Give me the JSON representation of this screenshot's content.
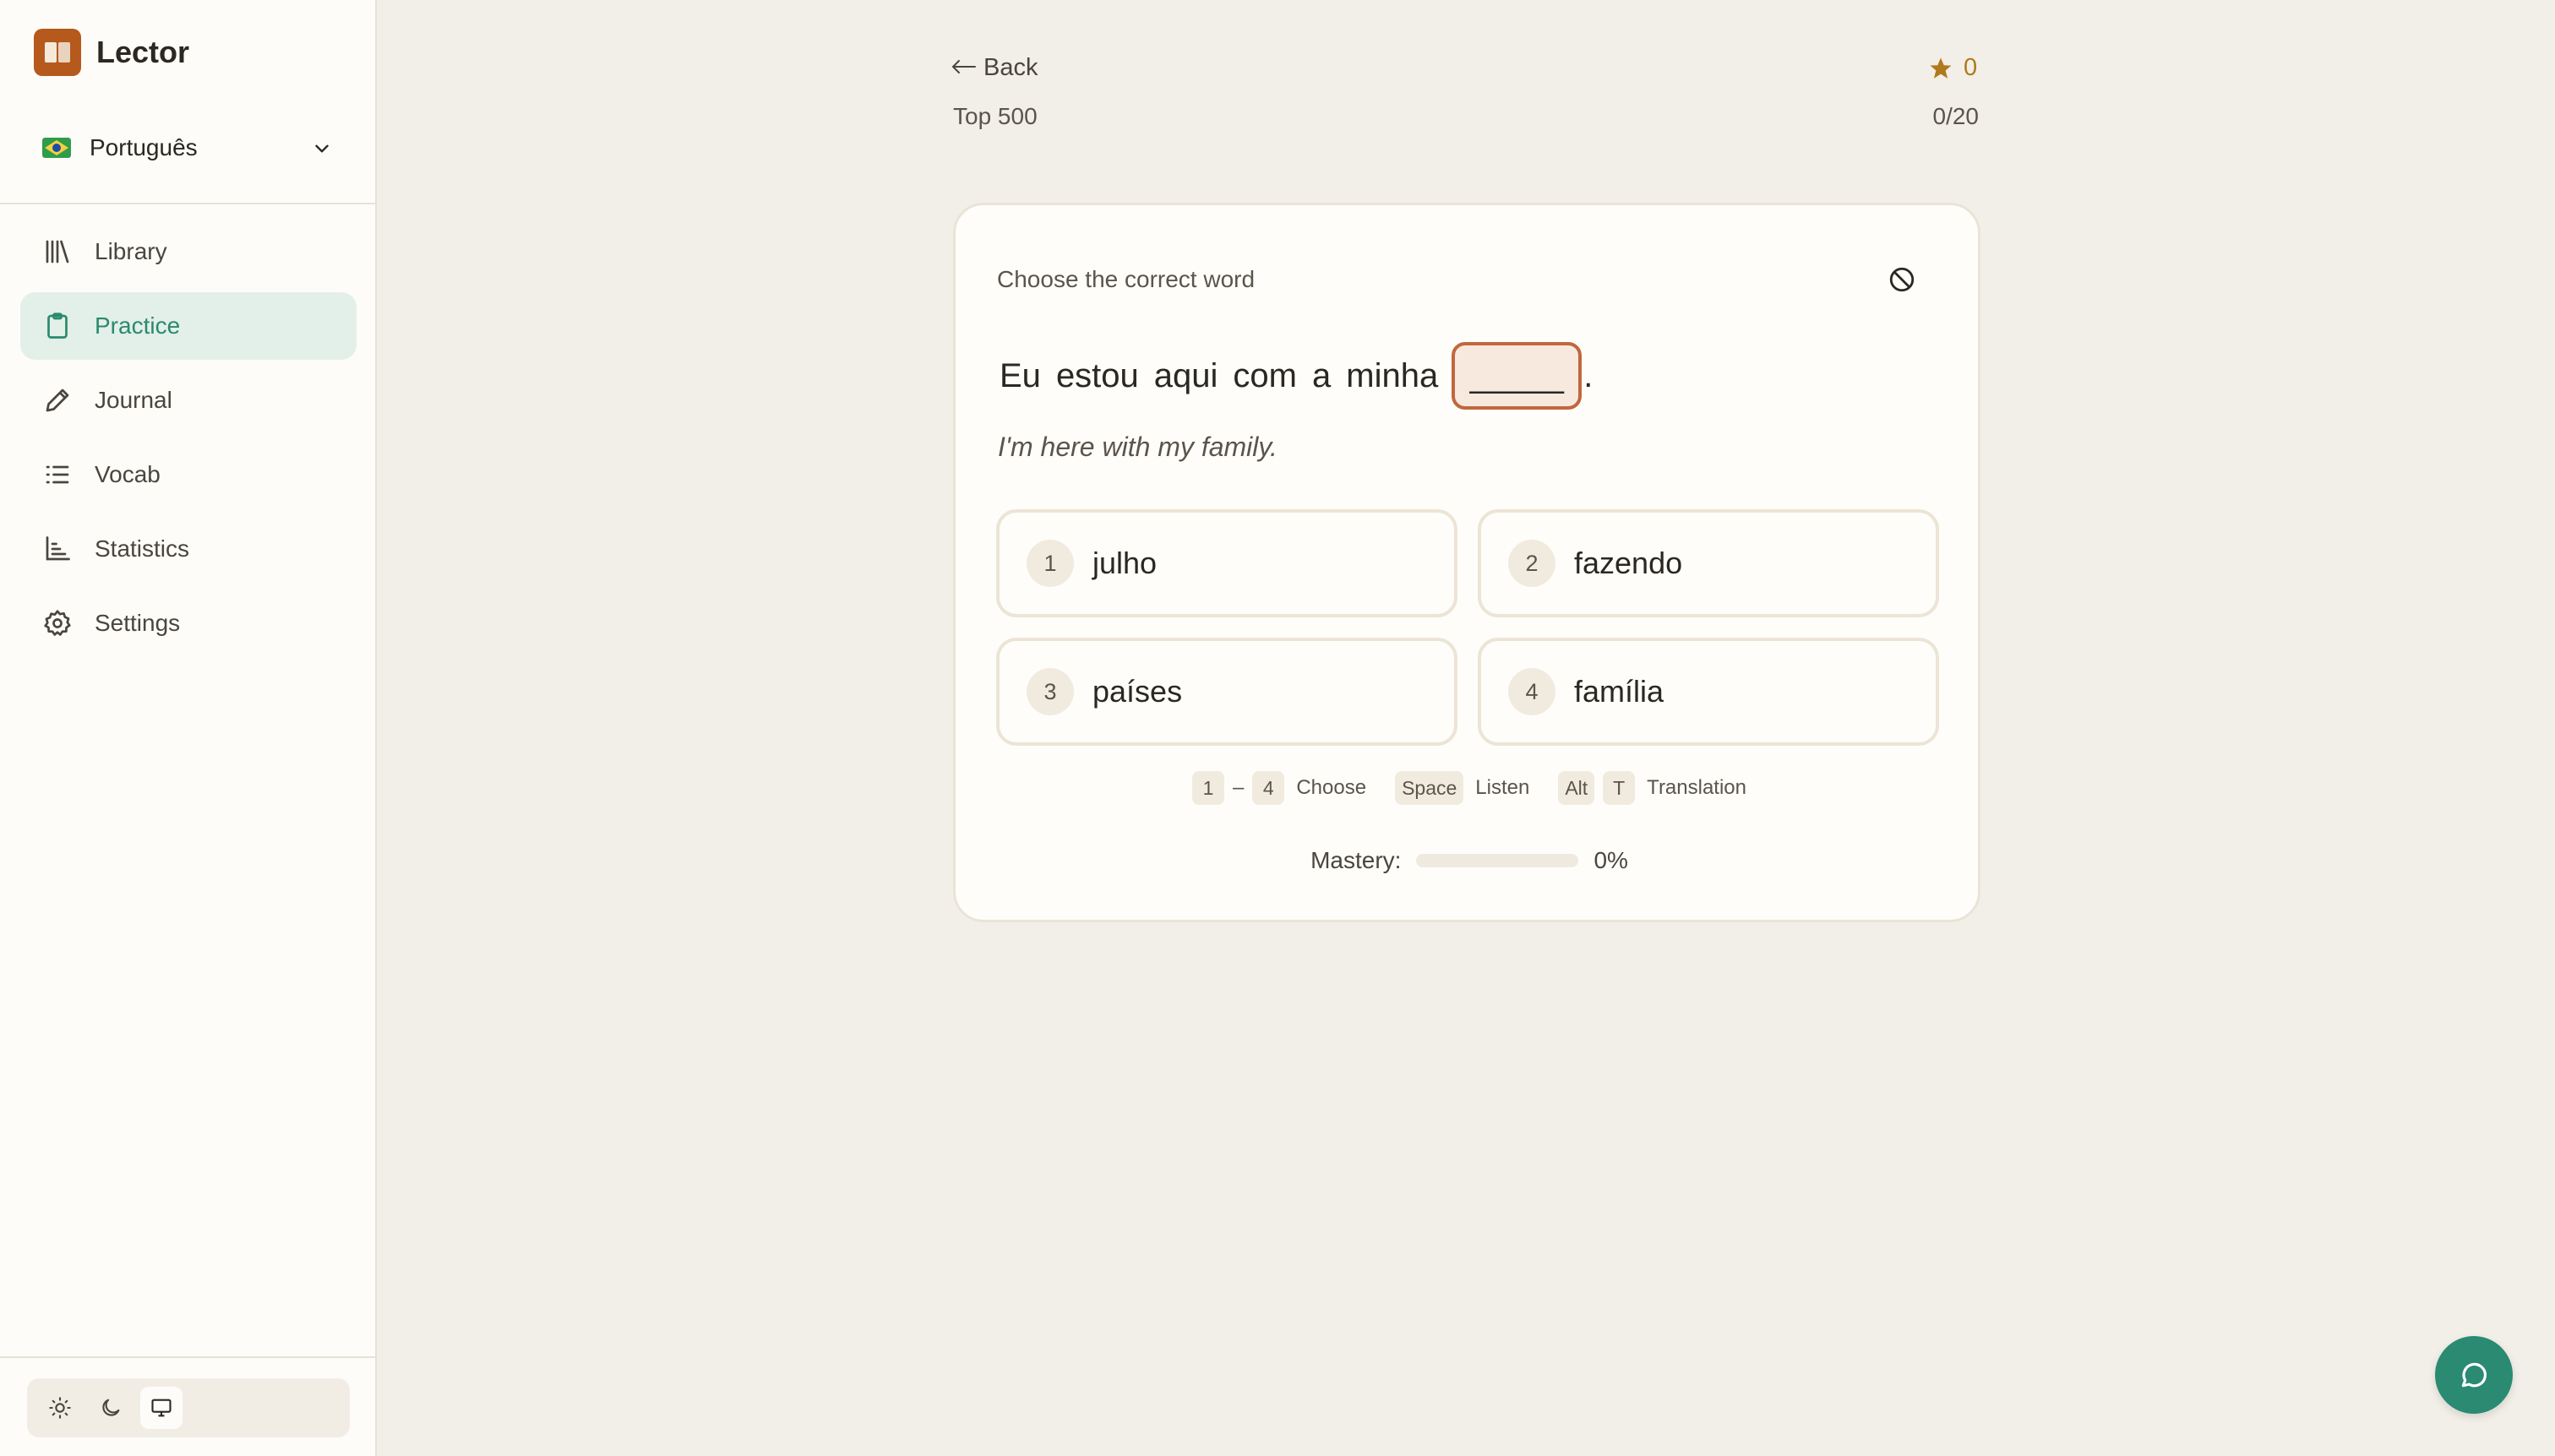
{
  "app": {
    "name": "Lector",
    "accent_color": "#2a8a6e",
    "brand_color": "#b55a1c"
  },
  "language": {
    "selected": "Português",
    "flag": "brazil-flag-icon"
  },
  "nav": {
    "items": [
      {
        "label": "Library",
        "icon": "library-icon",
        "active": false
      },
      {
        "label": "Practice",
        "icon": "clipboard-icon",
        "active": true
      },
      {
        "label": "Journal",
        "icon": "pencil-icon",
        "active": false
      },
      {
        "label": "Vocab",
        "icon": "list-icon",
        "active": false
      },
      {
        "label": "Statistics",
        "icon": "bar-chart-icon",
        "active": false
      },
      {
        "label": "Settings",
        "icon": "gear-icon",
        "active": false
      }
    ]
  },
  "theme": {
    "options": [
      "light",
      "dark",
      "system"
    ],
    "selected": "system"
  },
  "header": {
    "back_label": "Back",
    "deck_name": "Top 500",
    "score": "0",
    "progress": "0/20"
  },
  "card": {
    "prompt": "Choose the correct word",
    "sentence_words": [
      "Eu",
      "estou",
      "aqui",
      "com",
      "a",
      "minha"
    ],
    "blank": "_____",
    "sentence_end": ".",
    "translation": "I'm here with my family.",
    "options": [
      {
        "number": "1",
        "word": "julho"
      },
      {
        "number": "2",
        "word": "fazendo"
      },
      {
        "number": "3",
        "word": "países"
      },
      {
        "number": "4",
        "word": "família"
      }
    ],
    "hints": {
      "range_start": "1",
      "range_dash": "–",
      "range_end": "4",
      "choose_label": "Choose",
      "space_key": "Space",
      "listen_label": "Listen",
      "alt_key": "Alt",
      "t_key": "T",
      "translation_label": "Translation"
    },
    "mastery": {
      "label": "Mastery:",
      "value": 0,
      "value_label": "0%"
    }
  }
}
